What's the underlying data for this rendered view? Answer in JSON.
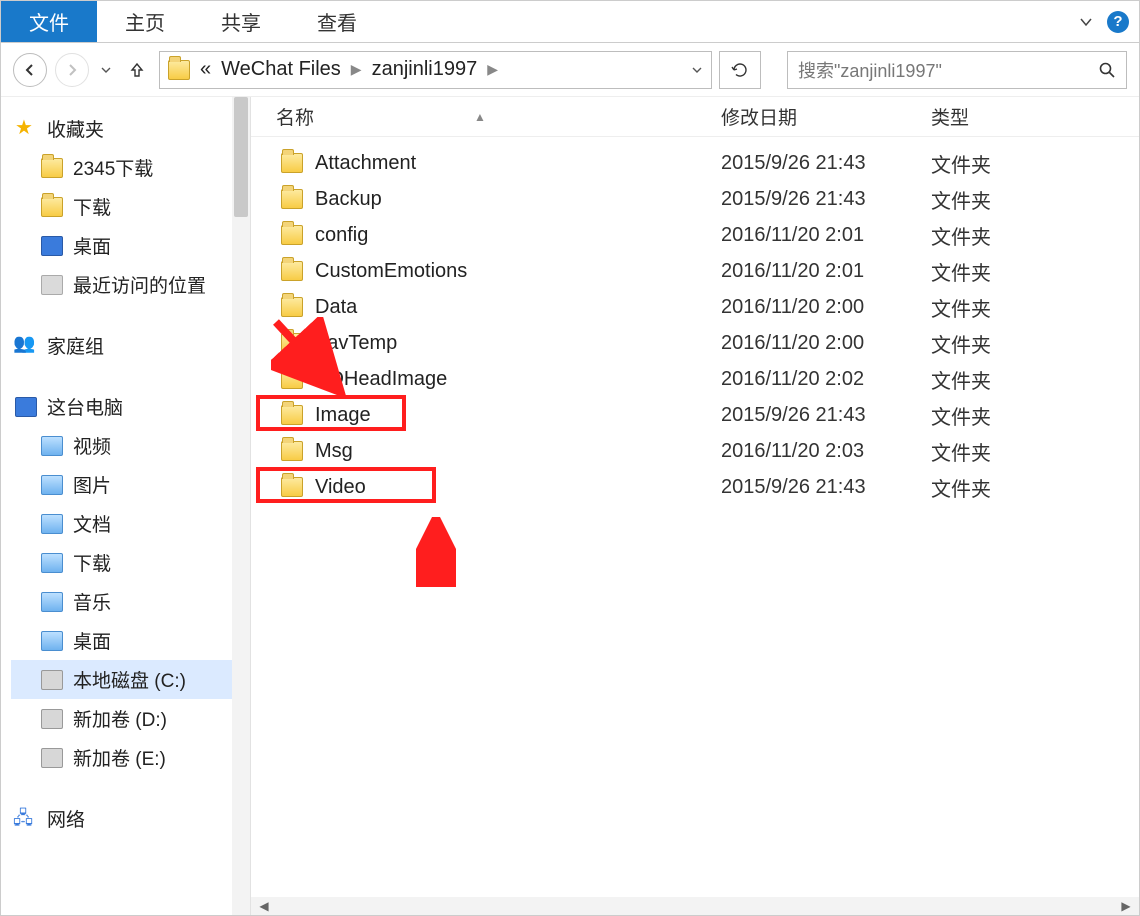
{
  "ribbon": {
    "file": "文件",
    "home": "主页",
    "share": "共享",
    "view": "查看"
  },
  "nav": {
    "breadcrumb_prefix": "«",
    "crumbs": [
      "WeChat Files",
      "zanjinli1997"
    ],
    "search_placeholder": "搜索\"zanjinli1997\""
  },
  "columns": {
    "name": "名称",
    "date": "修改日期",
    "type": "类型"
  },
  "sidebar": {
    "favorites": "收藏夹",
    "fav_items": [
      "2345下载",
      "下载",
      "桌面",
      "最近访问的位置"
    ],
    "homegroup": "家庭组",
    "this_pc": "这台电脑",
    "pc_items": [
      "视频",
      "图片",
      "文档",
      "下载",
      "音乐",
      "桌面",
      "本地磁盘 (C:)",
      "新加卷 (D:)",
      "新加卷 (E:)"
    ],
    "network": "网络"
  },
  "type_folder": "文件夹",
  "files": [
    {
      "name": "Attachment",
      "date": "2015/9/26 21:43"
    },
    {
      "name": "Backup",
      "date": "2015/9/26 21:43"
    },
    {
      "name": "config",
      "date": "2016/11/20 2:01"
    },
    {
      "name": "CustomEmotions",
      "date": "2016/11/20 2:01"
    },
    {
      "name": "Data",
      "date": "2016/11/20 2:00"
    },
    {
      "name": "FavTemp",
      "date": "2016/11/20 2:00"
    },
    {
      "name": "HDHeadImage",
      "date": "2016/11/20 2:02"
    },
    {
      "name": "Image",
      "date": "2015/9/26 21:43"
    },
    {
      "name": "Msg",
      "date": "2016/11/20 2:03"
    },
    {
      "name": "Video",
      "date": "2015/9/26 21:43"
    }
  ],
  "highlighted_rows": [
    7,
    9
  ]
}
